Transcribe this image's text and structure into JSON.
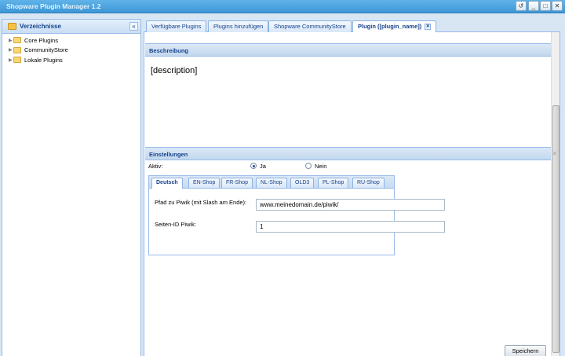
{
  "window": {
    "title": "Shopware Plugin Manager 1.2",
    "buttons": [
      "↺",
      "_",
      "□",
      "✕"
    ]
  },
  "sidebar": {
    "title": "Verzeichnisse",
    "collapse_glyph": "«",
    "items": [
      {
        "label": "Core Plugins"
      },
      {
        "label": "CommunityStore"
      },
      {
        "label": "Lokale Plugins"
      }
    ]
  },
  "tabs": [
    {
      "label": "Verfügbare Plugins",
      "active": false
    },
    {
      "label": "Plugins hinzufügen",
      "active": false
    },
    {
      "label": "Shopware CommunityStore",
      "active": false
    },
    {
      "label": "Plugin ([plugin_name])",
      "active": true
    }
  ],
  "description": {
    "heading": "Beschreibung",
    "text": "[description]"
  },
  "settings": {
    "heading": "Einstellungen",
    "active_label": "Aktiv:",
    "option_yes": "Ja",
    "option_no": "Nein",
    "selected": "Ja",
    "shop_tabs": [
      "Deutsch",
      "EN-Shop",
      "FR-Shop",
      "NL-Shop",
      "OLD3",
      "PL-Shop",
      "RU-Shop"
    ],
    "active_shop_tab": "Deutsch",
    "fields": [
      {
        "label": "Pfad zu Piwik (mit Slash am Ende):",
        "value": "www.meinedomain.de/piwik/"
      },
      {
        "label": "Seiten-ID Piwik:",
        "value": "1"
      }
    ]
  },
  "actions": {
    "save_label": "Speichern"
  }
}
